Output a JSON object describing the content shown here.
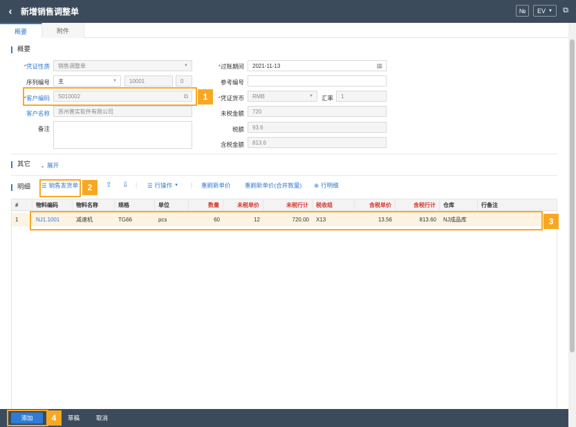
{
  "header": {
    "back_icon": "chevron-left-icon",
    "title": "新增销售调整单",
    "btn_no": "№",
    "btn_ev": "EV",
    "export_icon": "external-link-icon"
  },
  "tabs": [
    {
      "label": "概要",
      "active": true
    },
    {
      "label": "附件",
      "active": false
    }
  ],
  "summary": {
    "section_title": "概要",
    "voucher_type": {
      "label": "凭证性质",
      "value": "销售调整单"
    },
    "serial_no": {
      "label": "序列编号",
      "value": "主",
      "num": "10001",
      "suffix": "0"
    },
    "customer_code": {
      "label": "客户编码",
      "value": "S010002"
    },
    "customer_name": {
      "label": "客户名称",
      "value": "苏州普实软件有限公司"
    },
    "remark": {
      "label": "备注",
      "value": ""
    },
    "post_period": {
      "label": "过账期间",
      "value": "2021-11-13"
    },
    "ref_no": {
      "label": "参考编号",
      "value": ""
    },
    "currency": {
      "label": "凭证货币",
      "value": "RMB"
    },
    "exchange": {
      "label": "汇率",
      "value": "1"
    },
    "untaxed": {
      "label": "未税金额",
      "value": "720"
    },
    "tax": {
      "label": "税额",
      "value": "93.6"
    },
    "taxed": {
      "label": "含税金额",
      "value": "813.6"
    }
  },
  "other": {
    "section_title": "其它",
    "expand_label": "展开"
  },
  "detail": {
    "section_title": "明细",
    "toolbar": {
      "sales_delivery": "销售发货单",
      "row_ops": "行操作",
      "refresh_price": "重刷新单价",
      "refresh_price_merge": "重刷新单价(合并数量)",
      "row_detail": "行明细"
    },
    "columns": [
      "#",
      "物料编码",
      "物料名称",
      "规格",
      "单位",
      "数量",
      "未税单价",
      "未税行计",
      "税收组",
      "含税单价",
      "含税行计",
      "仓库",
      "行备注"
    ],
    "rows": [
      [
        "1",
        "NJ1.1001",
        "减速机",
        "TG66",
        "pcs",
        "60",
        "12",
        "720.00",
        "X13",
        "13.56",
        "813.60",
        "NJ成品库",
        ""
      ]
    ]
  },
  "footer": {
    "add": "添加",
    "draft": "草稿",
    "cancel": "取消"
  },
  "callouts": [
    "1",
    "2",
    "3",
    "4"
  ],
  "colors": {
    "header_bg": "#3c4b5c",
    "accent": "#2f7bd6",
    "callout": "#f7a823",
    "row_highlight": "#fdf3e3"
  }
}
